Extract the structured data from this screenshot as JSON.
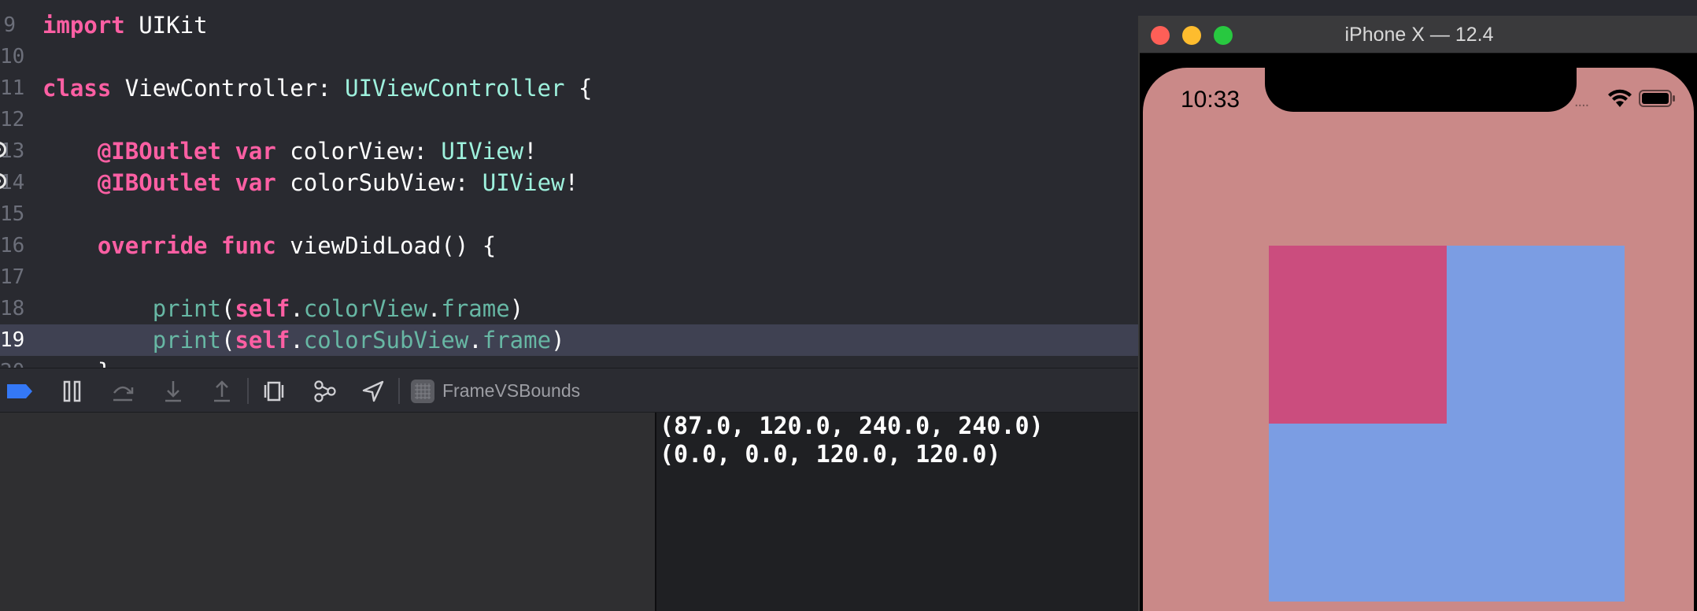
{
  "editor": {
    "lines": [
      {
        "number": "9",
        "segments": [
          {
            "cls": "kw",
            "text": "import"
          },
          {
            "cls": "pl",
            "text": " UIKit"
          }
        ]
      },
      {
        "number": "10",
        "segments": []
      },
      {
        "number": "11",
        "segments": [
          {
            "cls": "kw",
            "text": "class"
          },
          {
            "cls": "pl",
            "text": " ViewController: "
          },
          {
            "cls": "ty2",
            "text": "UIViewController"
          },
          {
            "cls": "pl",
            "text": " {"
          }
        ]
      },
      {
        "number": "12",
        "segments": []
      },
      {
        "number": "13",
        "marker": true,
        "segments": [
          {
            "cls": "pl",
            "text": "    "
          },
          {
            "cls": "kw",
            "text": "@IBOutlet"
          },
          {
            "cls": "pl",
            "text": " "
          },
          {
            "cls": "kw",
            "text": "var"
          },
          {
            "cls": "pl",
            "text": " colorView: "
          },
          {
            "cls": "ty2",
            "text": "UIView"
          },
          {
            "cls": "pl",
            "text": "!"
          }
        ]
      },
      {
        "number": "14",
        "marker": true,
        "segments": [
          {
            "cls": "pl",
            "text": "    "
          },
          {
            "cls": "kw",
            "text": "@IBOutlet"
          },
          {
            "cls": "pl",
            "text": " "
          },
          {
            "cls": "kw",
            "text": "var"
          },
          {
            "cls": "pl",
            "text": " colorSubView: "
          },
          {
            "cls": "ty2",
            "text": "UIView"
          },
          {
            "cls": "pl",
            "text": "!"
          }
        ]
      },
      {
        "number": "15",
        "segments": []
      },
      {
        "number": "16",
        "segments": [
          {
            "cls": "pl",
            "text": "    "
          },
          {
            "cls": "kw",
            "text": "override"
          },
          {
            "cls": "pl",
            "text": " "
          },
          {
            "cls": "kw",
            "text": "func"
          },
          {
            "cls": "pl",
            "text": " viewDidLoad() {"
          }
        ]
      },
      {
        "number": "17",
        "segments": []
      },
      {
        "number": "18",
        "segments": [
          {
            "cls": "pl",
            "text": "        "
          },
          {
            "cls": "fn",
            "text": "print"
          },
          {
            "cls": "pl",
            "text": "("
          },
          {
            "cls": "kw",
            "text": "self"
          },
          {
            "cls": "pl",
            "text": "."
          },
          {
            "cls": "prop",
            "text": "colorView"
          },
          {
            "cls": "pl",
            "text": "."
          },
          {
            "cls": "prop",
            "text": "frame"
          },
          {
            "cls": "pl",
            "text": ")"
          }
        ]
      },
      {
        "number": "19",
        "current": true,
        "segments": [
          {
            "cls": "pl",
            "text": "        "
          },
          {
            "cls": "fn",
            "text": "print"
          },
          {
            "cls": "pl",
            "text": "("
          },
          {
            "cls": "kw",
            "text": "self"
          },
          {
            "cls": "pl",
            "text": "."
          },
          {
            "cls": "prop",
            "text": "colorSubView"
          },
          {
            "cls": "pl",
            "text": "."
          },
          {
            "cls": "prop",
            "text": "frame"
          },
          {
            "cls": "pl",
            "text": ")"
          }
        ]
      },
      {
        "number": "20",
        "segments": [
          {
            "cls": "pl",
            "text": "    }"
          }
        ]
      }
    ]
  },
  "debug_bar": {
    "buttons": [
      {
        "name": "breakpoints-toggle-button",
        "icon": "breakpoint-icon"
      },
      {
        "name": "pause-continue-button",
        "icon": "pause-icon"
      },
      {
        "name": "step-over-button",
        "icon": "step-over-icon"
      },
      {
        "name": "step-into-button",
        "icon": "step-into-icon"
      },
      {
        "name": "step-out-button",
        "icon": "step-out-icon"
      },
      {
        "name": "view-hierarchy-button",
        "icon": "view-hierarchy-icon"
      },
      {
        "name": "memory-graph-button",
        "icon": "memory-graph-icon"
      },
      {
        "name": "simulate-location-button",
        "icon": "location-arrow-icon"
      }
    ],
    "scheme_label": "FrameVSBounds"
  },
  "console": {
    "lines": [
      "(87.0, 120.0, 240.0, 240.0)",
      "(0.0, 0.0, 120.0, 120.0)"
    ]
  },
  "simulator": {
    "title": "iPhone X — 12.4",
    "status_time": "10:33",
    "status_dots": "....",
    "colors": {
      "background": "#ca8988",
      "color_view": "#7b9de3",
      "color_sub_view": "#cb4d7e",
      "close": "#fe5f57",
      "minimize": "#febc2e",
      "zoom": "#28c840"
    }
  }
}
